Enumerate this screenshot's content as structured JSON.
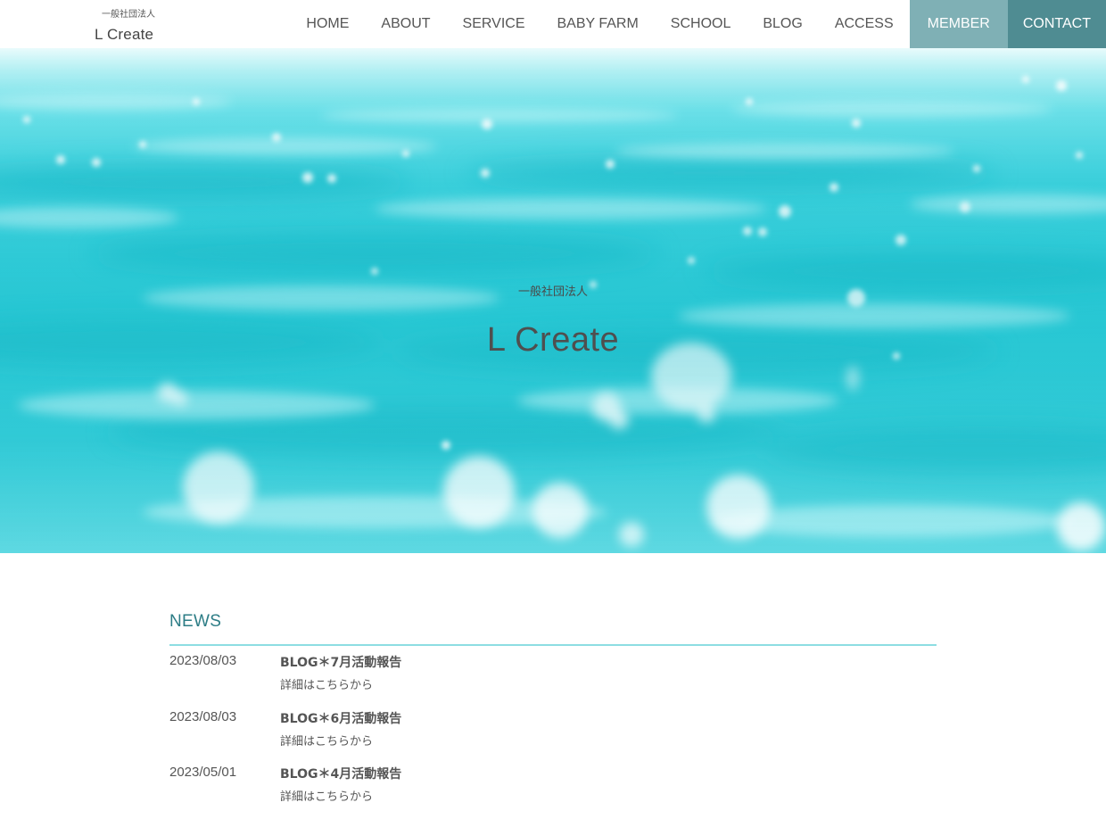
{
  "header": {
    "logo_sub": "一般社団法人",
    "logo_main": "L Create",
    "nav": [
      {
        "label": "HOME"
      },
      {
        "label": "ABOUT"
      },
      {
        "label": "SERVICE"
      },
      {
        "label": "BABY FARM"
      },
      {
        "label": "SCHOOL"
      },
      {
        "label": "BLOG"
      },
      {
        "label": "ACCESS"
      },
      {
        "label": "MEMBER"
      },
      {
        "label": "CONTACT"
      }
    ]
  },
  "hero": {
    "subtitle": "一般社団法人",
    "title": "L Create"
  },
  "news": {
    "heading": "NEWS",
    "items": [
      {
        "date": "2023/08/03",
        "title": "BLOG＊7月活動報告",
        "desc": "詳細はこちらから"
      },
      {
        "date": "2023/08/03",
        "title": "BLOG＊6月活動報告",
        "desc": "詳細はこちらから"
      },
      {
        "date": "2023/05/01",
        "title": "BLOG＊4月活動報告",
        "desc": "詳細はこちらから"
      }
    ]
  },
  "colors": {
    "accent": "#2d7d86",
    "news_rule": "#8ddde2",
    "member_bg": "#7fb0b5",
    "contact_bg": "#4f8c92",
    "sea": "#2ccbd7"
  }
}
